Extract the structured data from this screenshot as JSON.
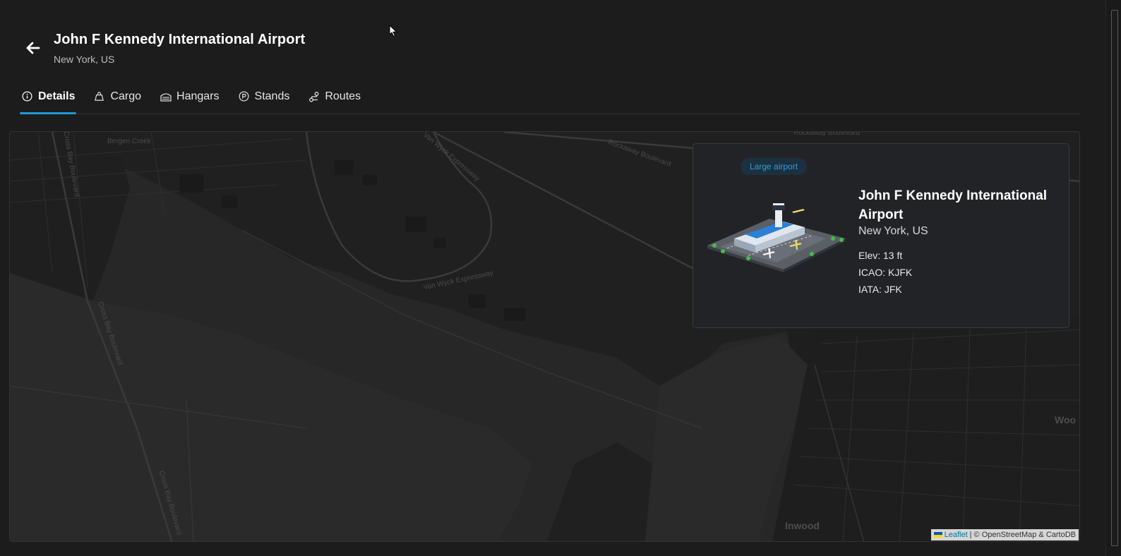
{
  "header": {
    "title": "John F Kennedy International Airport",
    "subtitle": "New York, US"
  },
  "tabs": [
    {
      "label": "Details",
      "icon": "info-icon",
      "active": true
    },
    {
      "label": "Cargo",
      "icon": "cargo-icon",
      "active": false
    },
    {
      "label": "Hangars",
      "icon": "hangar-icon",
      "active": false
    },
    {
      "label": "Stands",
      "icon": "parking-icon",
      "active": false
    },
    {
      "label": "Routes",
      "icon": "route-icon",
      "active": false
    }
  ],
  "card": {
    "badge": "Large airport",
    "name": "John F Kennedy International Airport",
    "city": "New York, US",
    "elevation": "Elev: 13 ft",
    "icao": "ICAO: KJFK",
    "iata": "IATA: JFK"
  },
  "map": {
    "labels": [
      "Bergen Creek",
      "Van Wyck Expressway",
      "Van Wyck Expressway",
      "Cross Bay Boulevard",
      "Cross Bay Boulevard",
      "Cross Bay Boulevard",
      "Rockaway Boulevard",
      "Inwood",
      "Woo",
      "Rockaway Boulevard"
    ],
    "attribution_leaflet": "Leaflet",
    "attribution_rest": "| © OpenStreetMap & CartoDB"
  },
  "colors": {
    "accent": "#1e9ad6",
    "background": "#1c1c1c",
    "card": "#222326",
    "badge_bg": "#1c3040",
    "badge_text": "#2e9fd8"
  }
}
